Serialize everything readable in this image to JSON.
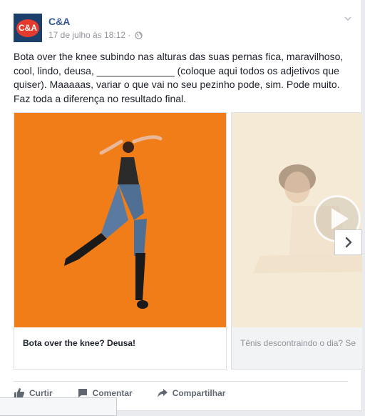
{
  "post": {
    "page_name": "C&A",
    "avatar_text": "C&A",
    "timestamp": "17 de julho às 18:12 ·",
    "text": "Bota over the knee subindo nas alturas das suas pernas fica, maravilhoso, cool, lindo, deusa, ______________ (coloque aqui todos os adjetivos que quiser). Maaaaas, variar o que vai no seu pezinho pode, sim. Pode muito. Faz toda a diferença no resultado final."
  },
  "carousel": {
    "cards": [
      {
        "title": "Bota over the knee? Deusa!"
      },
      {
        "title": "Tênis descontraindo o dia? Se"
      }
    ]
  },
  "actions": {
    "like": "Curtir",
    "comment": "Comentar",
    "share": "Compartilhar"
  },
  "colors": {
    "link": "#365899",
    "card1_bg": "#f07d18",
    "card2_bg": "#f4ead6"
  }
}
